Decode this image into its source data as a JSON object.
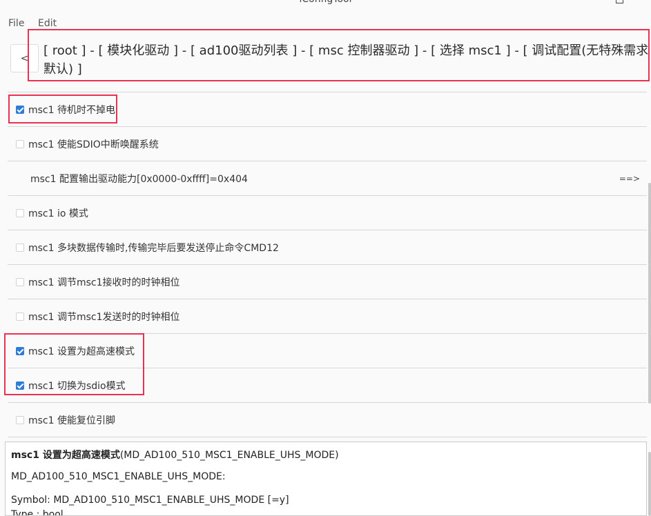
{
  "window": {
    "title": "iConfigTool"
  },
  "menu": {
    "file": "File",
    "edit": "Edit"
  },
  "nav": {
    "back_label": "<",
    "breadcrumb_line1": "[ root ] - [ 模块化驱动 ] - [ ad100驱动列表 ] - [ msc 控制器驱动 ] - [ 选择 msc1 ] - [ 调试配置(无特殊需求保持",
    "breadcrumb_line2": "默认) ]"
  },
  "options": [
    {
      "label": "msc1 待机时不掉电",
      "checked": true,
      "type": "checkbox"
    },
    {
      "label": "msc1  使能SDIO中断唤醒系统",
      "checked": false,
      "type": "checkbox"
    },
    {
      "label": "msc1  配置输出驱动能力[0x0000-0xffff]=0x404",
      "type": "value",
      "arrow": "==>"
    },
    {
      "label": "msc1 io 模式",
      "checked": false,
      "type": "checkbox"
    },
    {
      "label": "msc1 多块数据传输时,传输完毕后要发送停止命令CMD12",
      "checked": false,
      "type": "checkbox"
    },
    {
      "label": "msc1 调节msc1接收时的时钟相位",
      "checked": false,
      "type": "checkbox"
    },
    {
      "label": "msc1 调节msc1发送时的时钟相位",
      "checked": false,
      "type": "checkbox"
    },
    {
      "label": "msc1 设置为超高速模式",
      "checked": true,
      "type": "checkbox"
    },
    {
      "label": "msc1 切换为sdio模式",
      "checked": true,
      "type": "checkbox"
    },
    {
      "label": "msc1 使能复位引脚",
      "checked": false,
      "type": "checkbox"
    }
  ],
  "detail": {
    "name": "msc1 设置为超高速模式",
    "symbol_paren": "(MD_AD100_510_MSC1_ENABLE_UHS_MODE)",
    "line2": "MD_AD100_510_MSC1_ENABLE_UHS_MODE:",
    "line3": "Symbol: MD_AD100_510_MSC1_ENABLE_UHS_MODE [=y]",
    "line4": "Type : bool"
  },
  "colors": {
    "highlight": "#e8304f",
    "checkbox_checked": "#2f7cd6"
  }
}
